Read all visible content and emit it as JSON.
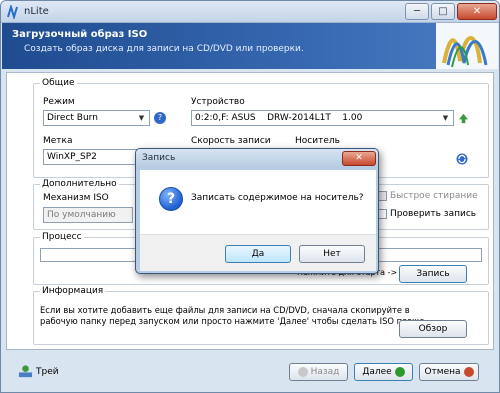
{
  "window": {
    "title": "nLite",
    "min_glyph": "─",
    "max_glyph": "□",
    "close_glyph": "✕"
  },
  "header": {
    "title": "Загрузочный образ ISO",
    "subtitle": "Создать образ диска для записи на CD/DVD или проверки."
  },
  "general": {
    "group_title": "Общие",
    "mode_label": "Режим",
    "mode_value": "Direct Burn",
    "device_label": "Устройство",
    "device_value": "0:2:0,F: ASUS    DRW-2014L1T    1.00",
    "label_label": "Метка",
    "label_value": "WinXP_SP2",
    "speed_label": "Скорость записи",
    "media_label": "Носитель"
  },
  "advanced": {
    "group_title": "Дополнительно",
    "iso_engine_label": "Механизм ISO",
    "iso_engine_value": "По умолчанию",
    "quick_erase_label": "Быстрое стирание",
    "verify_label": "Проверить запись"
  },
  "process": {
    "group_title": "Процесс",
    "hint": "Нажмите для старта ->",
    "burn_button": "Запись"
  },
  "info": {
    "group_title": "Информация",
    "text_line1": "Если вы хотите добавить еще файлы для записи на CD/DVD, сначала скопируйте в",
    "text_line2": "рабочую папку перед запуском или просто нажмите 'Далее' чтобы сделать ISO позже.",
    "browse_button": "Обзор"
  },
  "footer": {
    "tray_label": "Трей",
    "back_button": "Назад",
    "next_button": "Далее",
    "cancel_button": "Отмена"
  },
  "dialog": {
    "title": "Запись",
    "message": "Записать содержимое на носитель?",
    "yes_button": "Да",
    "no_button": "Нет",
    "close_glyph": "✕"
  },
  "colors": {
    "banner_blue": "#1f4b8f",
    "window_bg": "#d8e4f0",
    "close_red": "#c7492e",
    "next_green": "#2e9a2e"
  }
}
